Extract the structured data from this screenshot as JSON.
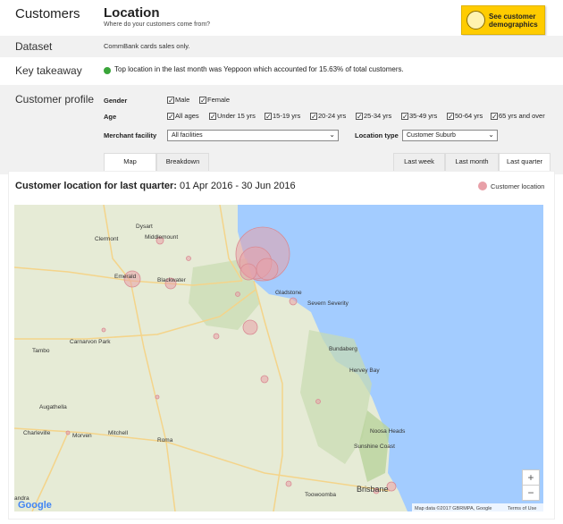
{
  "header": {
    "section": "Customers",
    "title": "Location",
    "subtitle": "Where do your customers come from?",
    "demographics_button": [
      "See customer",
      "demographics"
    ]
  },
  "dataset": {
    "label": "Dataset",
    "value": "CommBank cards sales only."
  },
  "key_takeaway": {
    "label": "Key takeaway",
    "text": "Top location in the last month was Yeppoon which accounted for 15.63% of total customers.",
    "status_color": "#3aa53a"
  },
  "profile": {
    "label": "Customer profile",
    "gender_label": "Gender",
    "gender": [
      "Male",
      "Female"
    ],
    "age_label": "Age",
    "ages": [
      "All ages",
      "Under 15 yrs",
      "15-19 yrs",
      "20-24 yrs",
      "25-34 yrs",
      "35-49 yrs",
      "50-64 yrs",
      "65 yrs and over"
    ],
    "merchant_label": "Merchant facility",
    "merchant_value": "All facilities",
    "location_type_label": "Location type",
    "location_type_value": "Customer Suburb"
  },
  "tabs": {
    "map": "Map",
    "breakdown": "Breakdown",
    "last_week": "Last week",
    "last_month": "Last month",
    "last_quarter": "Last quarter"
  },
  "chart": {
    "title_bold": "Customer location for last quarter:",
    "date_range": "01 Apr 2016 - 30 Jun 2016",
    "legend": "Customer location",
    "bubble_color": "#e8a0a8"
  },
  "map": {
    "places": [
      "Clermont",
      "Dysart",
      "Middlemount",
      "Emerald",
      "Blackwater",
      "Gladstone",
      "Severn Severity",
      "Bundaberg",
      "Hervey Bay",
      "Carnarvon Park",
      "Tambo",
      "Augathella",
      "Charleville",
      "Morven",
      "Mitchell",
      "Roma",
      "Noosa Heads",
      "Sunshine Coast",
      "Toowoomba",
      "Brisbane",
      "andra"
    ],
    "attribution": "Map data ©2017 GBRMPA, Google",
    "terms": "Terms of Use",
    "logo": "Google",
    "zoom_in": "+",
    "zoom_out": "−"
  }
}
